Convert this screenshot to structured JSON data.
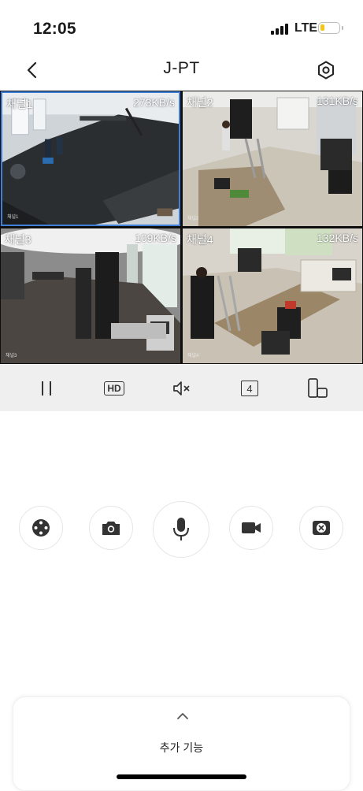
{
  "status_bar": {
    "time": "12:05",
    "network": "LTE",
    "battery_level": 0.25,
    "battery_color": "#f5c518"
  },
  "header": {
    "title": "J-PT",
    "back_icon": "chevron-left-icon",
    "settings_icon": "gear-icon"
  },
  "channels": [
    {
      "label": "채널1",
      "rate": "273KB/s",
      "stamp": "채널1",
      "selected": true
    },
    {
      "label": "채널2",
      "rate": "131KB/s",
      "stamp": "채널2",
      "selected": false
    },
    {
      "label": "채널3",
      "rate": "109KB/s",
      "stamp": "채널3",
      "selected": false
    },
    {
      "label": "채널4",
      "rate": "132KB/s",
      "stamp": "채널4",
      "selected": false
    }
  ],
  "controls": {
    "pause_icon": "pause-icon",
    "hd_label": "HD",
    "mute_icon": "speaker-muted-icon",
    "split_label": "4",
    "orientation_icon": "rotate-screen-icon"
  },
  "actions": [
    {
      "name": "ptz-control-button",
      "icon": "joystick-icon"
    },
    {
      "name": "snapshot-button",
      "icon": "camera-icon"
    },
    {
      "name": "talk-button",
      "icon": "microphone-icon"
    },
    {
      "name": "record-button",
      "icon": "video-camera-icon"
    },
    {
      "name": "close-camera-button",
      "icon": "target-x-icon"
    }
  ],
  "sheet": {
    "label": "추가 기능",
    "icon": "chevron-up-icon"
  },
  "colors": {
    "accent": "#3f7fd6",
    "control_bar_bg": "#efefef"
  }
}
